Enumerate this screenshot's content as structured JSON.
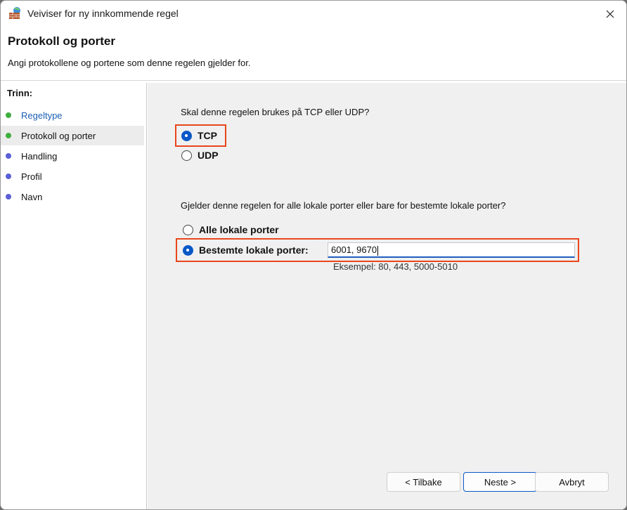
{
  "window": {
    "title": "Veiviser for ny innkommende regel",
    "icon": "firewall-brick-icon"
  },
  "header": {
    "title": "Protokoll og porter",
    "description": "Angi protokollene og portene som denne regelen gjelder for."
  },
  "sidebar": {
    "heading": "Trinn:",
    "steps": [
      {
        "label": "Regeltype",
        "status": "completed",
        "dot_color": "#3fae3f"
      },
      {
        "label": "Protokoll og porter",
        "status": "current",
        "dot_color": "#3fae3f"
      },
      {
        "label": "Handling",
        "status": "pending",
        "dot_color": "#5b5fd6"
      },
      {
        "label": "Profil",
        "status": "pending",
        "dot_color": "#5b5fd6"
      },
      {
        "label": "Navn",
        "status": "pending",
        "dot_color": "#5b5fd6"
      }
    ]
  },
  "protocol": {
    "question": "Skal denne regelen brukes på TCP eller UDP?",
    "options": [
      {
        "label": "TCP",
        "selected": true
      },
      {
        "label": "UDP",
        "selected": false
      }
    ]
  },
  "ports": {
    "question": "Gjelder denne regelen for alle lokale porter eller bare for bestemte lokale porter?",
    "options": [
      {
        "label": "Alle lokale porter",
        "selected": false
      },
      {
        "label": "Bestemte lokale porter:",
        "selected": true
      }
    ],
    "input_value": "6001, 9670",
    "example": "Eksempel: 80, 443, 5000-5010"
  },
  "buttons": {
    "back": "< Tilbake",
    "next": "Neste >",
    "cancel": "Avbryt"
  },
  "colors": {
    "highlight": "#e8461b",
    "accent": "#0a58c7",
    "link": "#1a5fb4"
  }
}
